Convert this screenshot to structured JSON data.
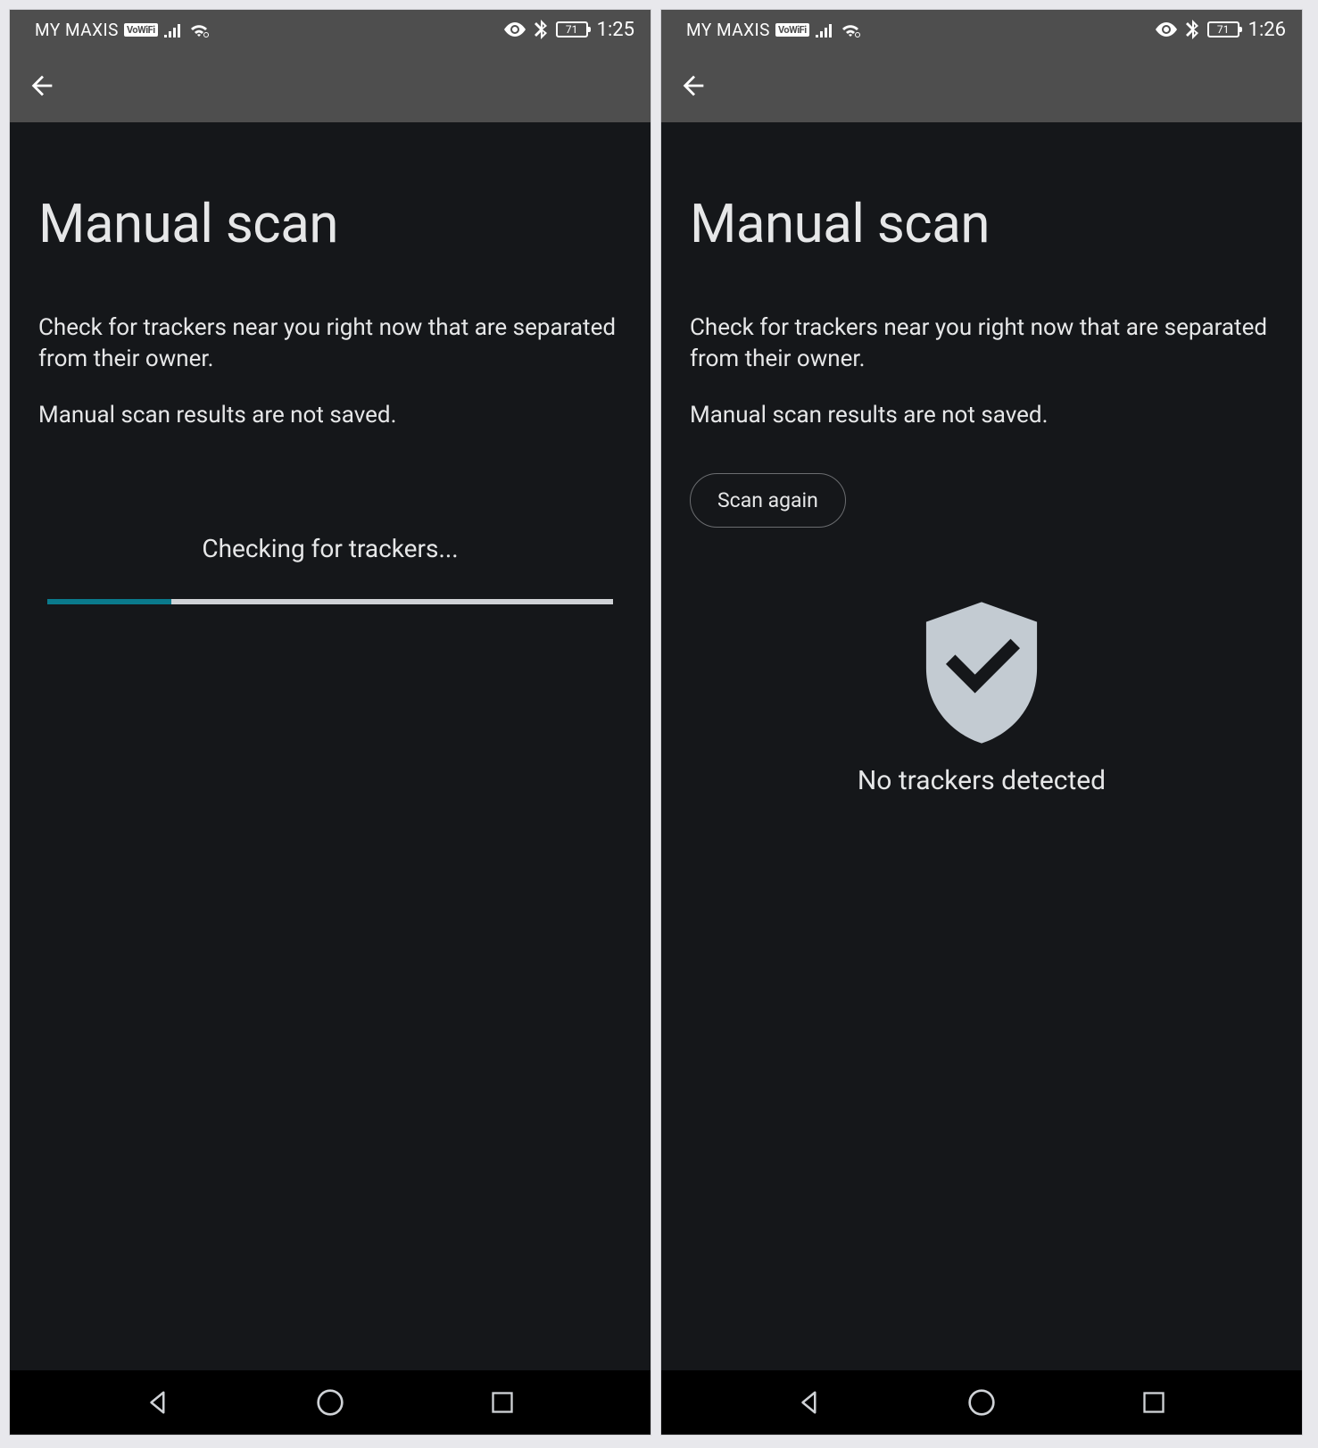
{
  "left": {
    "status": {
      "carrier": "MY MAXIS",
      "vowifi": "VoWiFi",
      "battery": "71",
      "time": "1:25"
    },
    "title": "Manual scan",
    "desc1": "Check for trackers near you right now that are separated from their owner.",
    "desc2": "Manual scan results are not saved.",
    "progress_label": "Checking for trackers...",
    "progress_pct": 22
  },
  "right": {
    "status": {
      "carrier": "MY MAXIS",
      "vowifi": "VoWiFi",
      "battery": "71",
      "time": "1:26"
    },
    "title": "Manual scan",
    "desc1": "Check for trackers near you right now that are separated from their owner.",
    "desc2": "Manual scan results are not saved.",
    "scan_again": "Scan again",
    "result_label": "No trackers detected"
  }
}
